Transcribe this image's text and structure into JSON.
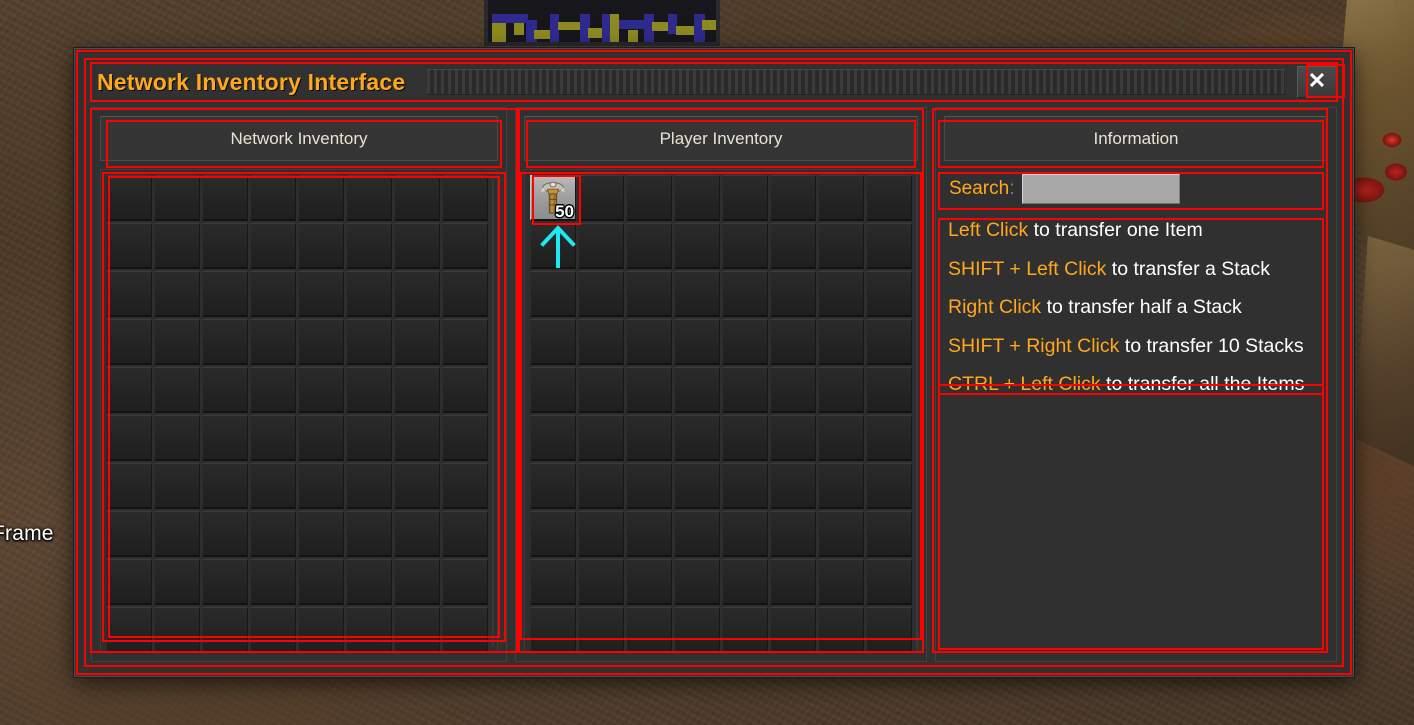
{
  "window": {
    "title": "Network Inventory Interface",
    "close_label": "✕",
    "close_icon": "close-icon",
    "drag_handle_icon": "drag-handle-icon"
  },
  "network_panel": {
    "header": "Network Inventory",
    "columns": 8,
    "rows": 10,
    "slots_total": 80,
    "filled_slots": [],
    "scrollbar": true
  },
  "player_panel": {
    "header": "Player Inventory",
    "columns": 8,
    "rows": 10,
    "slots_total": 80,
    "filled_slots": [
      {
        "index": 0,
        "icon": "tool-item-icon",
        "count": "50"
      }
    ],
    "scrollbar": true
  },
  "info_panel": {
    "header": "Information",
    "search_label": "Search",
    "search_colon": ":",
    "search_value": "",
    "search_placeholder": "",
    "lines": [
      {
        "key": "Left Click",
        "rest": " to transfer one Item"
      },
      {
        "key": "SHIFT + Left Click",
        "rest": " to transfer a Stack"
      },
      {
        "key": "Right Click",
        "rest": " to transfer half a Stack"
      },
      {
        "key": "SHIFT + Right Click",
        "rest": " to transfer 10 Stacks"
      },
      {
        "key": "CTRL + Left Click",
        "rest": " to transfer all the Items"
      }
    ]
  },
  "annotations": {
    "frame_label": "Frame",
    "highlight_color": "#ff0000",
    "arrow_color": "#1ee8f0"
  },
  "colors": {
    "accent_orange": "#ffa81e",
    "panel_bg": "#303030",
    "window_bg": "#313131",
    "text_light": "#e9e3d3",
    "annotation_red": "#ff0000",
    "arrow_cyan": "#1ee8f0",
    "search_field": "#a8a8a8"
  }
}
